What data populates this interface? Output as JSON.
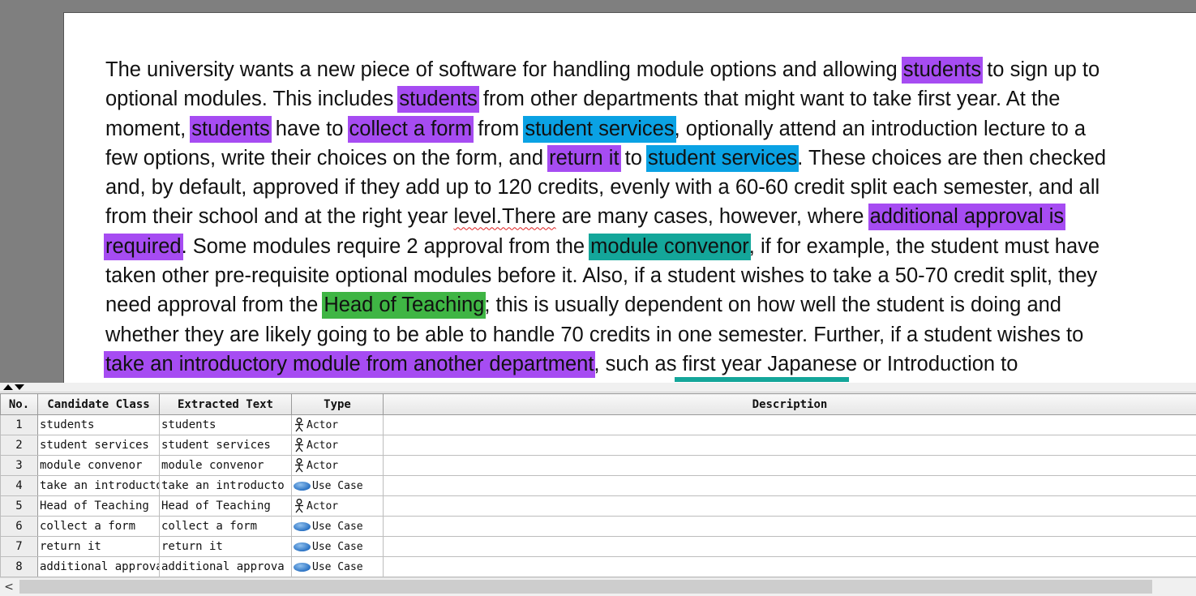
{
  "document": {
    "lines": [
      [
        {
          "t": "The university wants a new piece of software for handling module options and allowing "
        },
        {
          "t": "students",
          "hl": "actor"
        },
        {
          "t": " to sign up to"
        }
      ],
      [
        {
          "t": "optional modules. This includes "
        },
        {
          "t": "students",
          "hl": "actor"
        },
        {
          "t": " from other departments that might want to take first year. At the"
        }
      ],
      [
        {
          "t": "moment, "
        },
        {
          "t": "students",
          "hl": "actor"
        },
        {
          "t": " have to "
        },
        {
          "t": "collect a form",
          "hl": "usecase"
        },
        {
          "t": " from "
        },
        {
          "t": "student services",
          "hl": "blue"
        },
        {
          "t": ", optionally attend an introduction lecture to a"
        }
      ],
      [
        {
          "t": "few options, write their choices on the form, and "
        },
        {
          "t": "return it",
          "hl": "usecase"
        },
        {
          "t": " to "
        },
        {
          "t": "student services",
          "hl": "blue"
        },
        {
          "t": ". These choices are then checked"
        }
      ],
      [
        {
          "t": "and, by default, approved if they add up to 120 credits, evenly with a 60-60 credit split each semester, and all"
        }
      ],
      [
        {
          "t": "from their school and at the right year "
        },
        {
          "t": "level.There",
          "sq": true
        },
        {
          "t": " are many cases, however, where "
        },
        {
          "t": "additional approval is ",
          "hl": "usecase"
        }
      ],
      [
        {
          "t": "required",
          "hl": "usecase"
        },
        {
          "t": ". Some modules require 2 approval from the "
        },
        {
          "t": "module convenor",
          "hl": "teal"
        },
        {
          "t": ", if for example, the student must have"
        }
      ],
      [
        {
          "t": "taken other pre-requisite optional modules before it. Also, if a student wishes to take a 50-70 credit split, they"
        }
      ],
      [
        {
          "t": "need approval from the "
        },
        {
          "t": "Head of Teaching",
          "hl": "green"
        },
        {
          "t": "; this is usually dependent on how well the student is doing and"
        }
      ],
      [
        {
          "t": "whether they are likely going to be able to handle 70 credits in one semester. Further, if a student wishes to"
        }
      ],
      [
        {
          "t": "take an introductory module from another department",
          "hl": "usecase"
        },
        {
          "t": ", such as first year Japanese or Introduction to"
        }
      ]
    ]
  },
  "colors": {
    "actor_highlight": "#a64cf2",
    "usecase_highlight": "#a64cf2",
    "services_highlight": "#0aa2e4",
    "convenor_highlight": "#14a69a",
    "teaching_highlight": "#3fb544"
  },
  "table": {
    "headers": {
      "no": "No.",
      "candidate_class": "Candidate Class",
      "extracted_text": "Extracted Text",
      "type": "Type",
      "description": "Description"
    },
    "rows": [
      {
        "no": "1",
        "candidate_class": "students",
        "extracted_text": "students",
        "type": "Actor",
        "icon": "actor-icon",
        "description": ""
      },
      {
        "no": "2",
        "candidate_class": "student services",
        "extracted_text": "student services",
        "type": "Actor",
        "icon": "actor-icon",
        "description": ""
      },
      {
        "no": "3",
        "candidate_class": "module convenor",
        "extracted_text": "module convenor",
        "type": "Actor",
        "icon": "actor-icon",
        "description": ""
      },
      {
        "no": "4",
        "candidate_class": "take an introducto",
        "extracted_text": "take an introducto",
        "type": "Use Case",
        "icon": "use-case-icon",
        "description": ""
      },
      {
        "no": "5",
        "candidate_class": "Head of Teaching",
        "extracted_text": "Head of Teaching",
        "type": "Actor",
        "icon": "actor-icon",
        "description": ""
      },
      {
        "no": "6",
        "candidate_class": "collect a form",
        "extracted_text": "collect a form",
        "type": "Use Case",
        "icon": "use-case-icon",
        "description": ""
      },
      {
        "no": "7",
        "candidate_class": "return it",
        "extracted_text": "return it",
        "type": "Use Case",
        "icon": "use-case-icon",
        "description": ""
      },
      {
        "no": "8",
        "candidate_class": "additional approva",
        "extracted_text": "additional approva",
        "type": "Use Case",
        "icon": "use-case-icon",
        "description": ""
      }
    ]
  },
  "scrollbar": {
    "left_arrow": "<"
  }
}
